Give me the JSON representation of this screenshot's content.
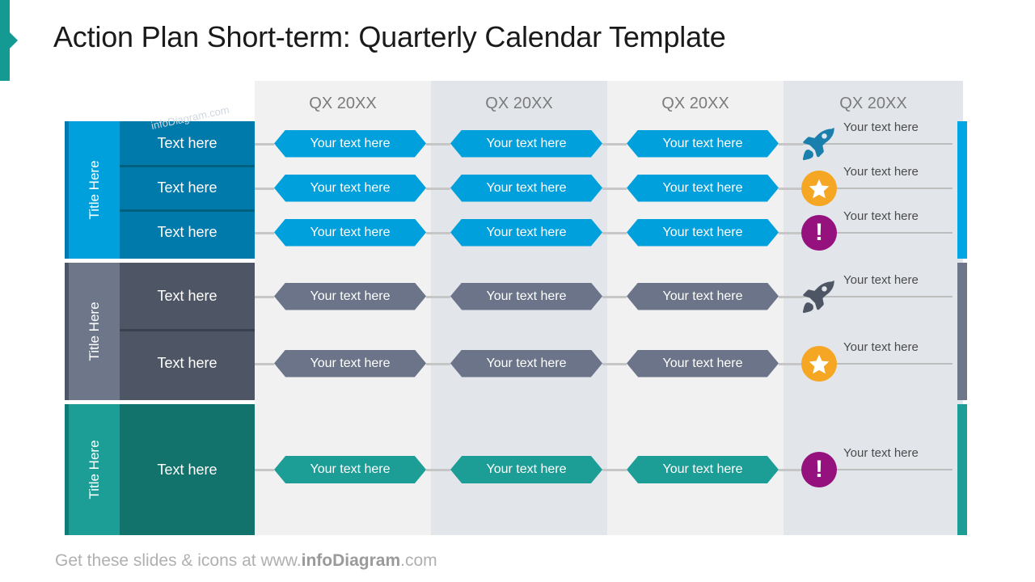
{
  "slide": {
    "title": "Action Plan Short-term: Quarterly Calendar Template",
    "watermark": "infoDiagram.com"
  },
  "footer": {
    "prefix": "Get these slides & icons at www.",
    "brand": "infoDiagram",
    "suffix": ".com"
  },
  "columns": [
    {
      "label": "QX 20XX",
      "bg": "#f1f1f1"
    },
    {
      "label": "QX 20XX",
      "bg": "#e2e6eb"
    },
    {
      "label": "QX 20XX",
      "bg": "#f1f1f1"
    },
    {
      "label": "QX 20XX",
      "bg": "#e2e6eb"
    }
  ],
  "groups": [
    {
      "side_label": "Title Here",
      "side_color": "#00a0dd",
      "edge_color": "#0079b0",
      "body_color": "#0079ab",
      "divider_color": "#00607f",
      "chevron_color": "#00a0dd",
      "accent_color": "#00a6e2",
      "rows": [
        {
          "label": "Text here"
        },
        {
          "label": "Text here"
        },
        {
          "label": "Text here"
        }
      ],
      "steps": [
        {
          "label": "Your text here"
        },
        {
          "label": "Your text here"
        },
        {
          "label": "Your text here"
        }
      ],
      "notes": [
        {
          "label": "Your text here",
          "icon": "rocket-icon",
          "icon_color": "#1a7fad"
        },
        {
          "label": "Your text here",
          "icon": "star-icon",
          "icon_color": "#f5a623"
        },
        {
          "label": "Your text here",
          "icon": "exclamation-icon",
          "icon_color": "#95117e"
        }
      ]
    },
    {
      "side_label": "Title Here",
      "side_color": "#6e7789",
      "edge_color": "#4d5666",
      "body_color": "#4e5665",
      "divider_color": "#3a414e",
      "chevron_color": "#6b7488",
      "accent_color": "#6e7789",
      "rows": [
        {
          "label": "Text here"
        },
        {
          "label": "Text here"
        }
      ],
      "steps": [
        {
          "label": "Your text here"
        },
        {
          "label": "Your text here"
        }
      ],
      "notes": [
        {
          "label": "Your text here",
          "icon": "rocket-icon",
          "icon_color": "#4e5665"
        },
        {
          "label": "Your text here",
          "icon": "star-icon",
          "icon_color": "#f5a623"
        }
      ]
    },
    {
      "side_label": "Title Here",
      "side_color": "#1c9e96",
      "edge_color": "#0f7c76",
      "body_color": "#12736d",
      "divider_color": "#0b5a55",
      "chevron_color": "#1c9e96",
      "accent_color": "#1c9e96",
      "rows": [
        {
          "label": "Text here"
        }
      ],
      "steps": [
        {
          "label": "Your text here"
        }
      ],
      "notes": [
        {
          "label": "Your text here",
          "icon": "exclamation-icon",
          "icon_color": "#95117e"
        }
      ]
    }
  ]
}
